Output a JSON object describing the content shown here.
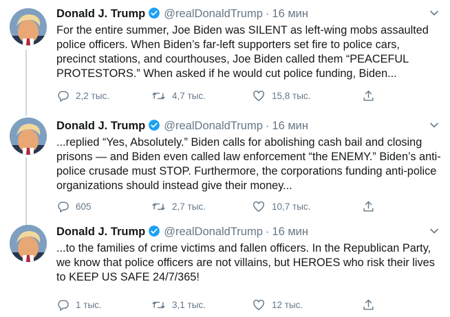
{
  "tweets": [
    {
      "name": "Donald J. Trump",
      "handle": "@realDonaldTrump",
      "separator": "·",
      "time": "16 мин",
      "text": "For the entire summer, Joe Biden was SILENT as left-wing mobs assaulted police officers. When Biden’s far-left supporters set fire to police cars, precinct stations, and courthouses, Joe Biden called them “PEACEFUL PROTESTORS.” When asked if he would cut police funding, Biden...",
      "replies": "2,2 тыс.",
      "retweets": "4,7 тыс.",
      "likes": "15,8 тыс."
    },
    {
      "name": "Donald J. Trump",
      "handle": "@realDonaldTrump",
      "separator": "·",
      "time": "16 мин",
      "text": "...replied “Yes, Absolutely.” Biden calls for abolishing cash bail and closing prisons — and Biden even called law enforcement “the ENEMY.” Biden’s anti-police crusade must STOP. Furthermore, the corporations funding anti-police organizations should instead give their money...",
      "replies": "605",
      "retweets": "2,7 тыс.",
      "likes": "10,7 тыс."
    },
    {
      "name": "Donald J. Trump",
      "handle": "@realDonaldTrump",
      "separator": "·",
      "time": "16 мин",
      "text": "...to the families of crime victims and fallen officers. In the Republican Party, we know that police officers are not villains, but HEROES who risk their lives to KEEP US SAFE 24/7/365!",
      "replies": "1 тыс.",
      "retweets": "3,1 тыс.",
      "likes": "12 тыс."
    }
  ],
  "icons": [
    "avatar",
    "verified-badge-icon",
    "chevron-down-icon",
    "reply-icon",
    "retweet-icon",
    "like-icon",
    "share-icon"
  ],
  "colors": {
    "text": "#14171a",
    "secondary": "#657786",
    "verified": "#1da1f2",
    "thread_line": "#ccd6dd"
  }
}
